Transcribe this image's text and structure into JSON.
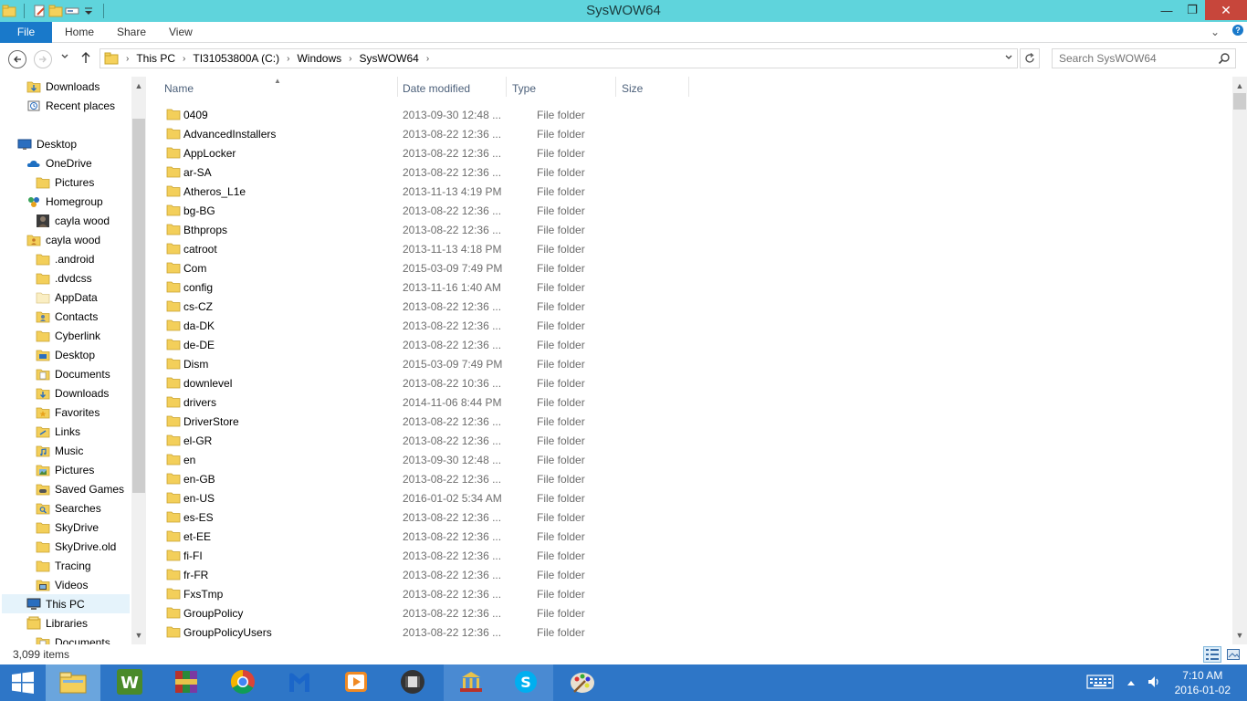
{
  "window": {
    "title": "SysWOW64",
    "minimize": "—",
    "maximize": "❐",
    "close": "✕"
  },
  "ribbon": {
    "tabs": [
      "File",
      "Home",
      "Share",
      "View"
    ],
    "expand": "⌄",
    "help": "?"
  },
  "address": {
    "crumbs": [
      "This PC",
      "TI31053800A (C:)",
      "Windows",
      "SysWOW64"
    ],
    "separator": "›"
  },
  "search": {
    "placeholder": "Search SysWOW64"
  },
  "nav": {
    "items": [
      {
        "label": "Downloads",
        "icon": "downloads-folder-icon"
      },
      {
        "label": "Recent places",
        "icon": "recent-places-icon"
      },
      {
        "label": "Desktop",
        "icon": "desktop-icon"
      },
      {
        "label": "OneDrive",
        "icon": "onedrive-icon"
      },
      {
        "label": "Pictures",
        "icon": "folder-icon"
      },
      {
        "label": "Homegroup",
        "icon": "homegroup-icon"
      },
      {
        "label": "cayla wood",
        "icon": "user-avatar-icon"
      },
      {
        "label": "cayla wood",
        "icon": "user-folder-icon"
      },
      {
        "label": ".android",
        "icon": "folder-icon"
      },
      {
        "label": ".dvdcss",
        "icon": "folder-icon"
      },
      {
        "label": "AppData",
        "icon": "hidden-folder-icon"
      },
      {
        "label": "Contacts",
        "icon": "contacts-folder-icon"
      },
      {
        "label": "Cyberlink",
        "icon": "folder-icon"
      },
      {
        "label": "Desktop",
        "icon": "desktop-folder-icon"
      },
      {
        "label": "Documents",
        "icon": "documents-folder-icon"
      },
      {
        "label": "Downloads",
        "icon": "downloads-folder-icon"
      },
      {
        "label": "Favorites",
        "icon": "favorites-folder-icon"
      },
      {
        "label": "Links",
        "icon": "links-folder-icon"
      },
      {
        "label": "Music",
        "icon": "music-folder-icon"
      },
      {
        "label": "Pictures",
        "icon": "pictures-folder-icon"
      },
      {
        "label": "Saved Games",
        "icon": "saved-games-folder-icon"
      },
      {
        "label": "Searches",
        "icon": "searches-folder-icon"
      },
      {
        "label": "SkyDrive",
        "icon": "folder-icon"
      },
      {
        "label": "SkyDrive.old",
        "icon": "folder-icon"
      },
      {
        "label": "Tracing",
        "icon": "folder-icon"
      },
      {
        "label": "Videos",
        "icon": "videos-folder-icon"
      },
      {
        "label": "This PC",
        "icon": "this-pc-icon"
      },
      {
        "label": "Libraries",
        "icon": "libraries-icon"
      },
      {
        "label": "Documents",
        "icon": "documents-folder-icon"
      }
    ]
  },
  "columns": {
    "name": "Name",
    "date": "Date modified",
    "type": "Type",
    "size": "Size"
  },
  "files": [
    {
      "name": "0409",
      "date": "2013-09-30 12:48 ...",
      "type": "File folder"
    },
    {
      "name": "AdvancedInstallers",
      "date": "2013-08-22 12:36 ...",
      "type": "File folder"
    },
    {
      "name": "AppLocker",
      "date": "2013-08-22 12:36 ...",
      "type": "File folder"
    },
    {
      "name": "ar-SA",
      "date": "2013-08-22 12:36 ...",
      "type": "File folder"
    },
    {
      "name": "Atheros_L1e",
      "date": "2013-11-13 4:19 PM",
      "type": "File folder"
    },
    {
      "name": "bg-BG",
      "date": "2013-08-22 12:36 ...",
      "type": "File folder"
    },
    {
      "name": "Bthprops",
      "date": "2013-08-22 12:36 ...",
      "type": "File folder"
    },
    {
      "name": "catroot",
      "date": "2013-11-13 4:18 PM",
      "type": "File folder"
    },
    {
      "name": "Com",
      "date": "2015-03-09 7:49 PM",
      "type": "File folder"
    },
    {
      "name": "config",
      "date": "2013-11-16 1:40 AM",
      "type": "File folder"
    },
    {
      "name": "cs-CZ",
      "date": "2013-08-22 12:36 ...",
      "type": "File folder"
    },
    {
      "name": "da-DK",
      "date": "2013-08-22 12:36 ...",
      "type": "File folder"
    },
    {
      "name": "de-DE",
      "date": "2013-08-22 12:36 ...",
      "type": "File folder"
    },
    {
      "name": "Dism",
      "date": "2015-03-09 7:49 PM",
      "type": "File folder"
    },
    {
      "name": "downlevel",
      "date": "2013-08-22 10:36 ...",
      "type": "File folder"
    },
    {
      "name": "drivers",
      "date": "2014-11-06 8:44 PM",
      "type": "File folder"
    },
    {
      "name": "DriverStore",
      "date": "2013-08-22 12:36 ...",
      "type": "File folder"
    },
    {
      "name": "el-GR",
      "date": "2013-08-22 12:36 ...",
      "type": "File folder"
    },
    {
      "name": "en",
      "date": "2013-09-30 12:48 ...",
      "type": "File folder"
    },
    {
      "name": "en-GB",
      "date": "2013-08-22 12:36 ...",
      "type": "File folder"
    },
    {
      "name": "en-US",
      "date": "2016-01-02 5:34 AM",
      "type": "File folder"
    },
    {
      "name": "es-ES",
      "date": "2013-08-22 12:36 ...",
      "type": "File folder"
    },
    {
      "name": "et-EE",
      "date": "2013-08-22 12:36 ...",
      "type": "File folder"
    },
    {
      "name": "fi-FI",
      "date": "2013-08-22 12:36 ...",
      "type": "File folder"
    },
    {
      "name": "fr-FR",
      "date": "2013-08-22 12:36 ...",
      "type": "File folder"
    },
    {
      "name": "FxsTmp",
      "date": "2013-08-22 12:36 ...",
      "type": "File folder"
    },
    {
      "name": "GroupPolicy",
      "date": "2013-08-22 12:36 ...",
      "type": "File folder"
    },
    {
      "name": "GroupPolicyUsers",
      "date": "2013-08-22 12:36 ...",
      "type": "File folder"
    }
  ],
  "status": {
    "count": "3,099 items"
  },
  "taskbar": {
    "apps": [
      {
        "name": "file-explorer",
        "icon": "file-explorer-icon",
        "state": "active"
      },
      {
        "name": "wordperfect",
        "icon": "wordperfect-icon",
        "state": "idle"
      },
      {
        "name": "winrar",
        "icon": "winrar-icon",
        "state": "idle"
      },
      {
        "name": "chrome",
        "icon": "chrome-icon",
        "state": "idle"
      },
      {
        "name": "malwarebytes",
        "icon": "malwarebytes-icon",
        "state": "idle"
      },
      {
        "name": "media-player",
        "icon": "media-player-icon",
        "state": "idle"
      },
      {
        "name": "video-editor",
        "icon": "video-editor-icon",
        "state": "idle"
      },
      {
        "name": "museum-app",
        "icon": "museum-app-icon",
        "state": "running"
      },
      {
        "name": "skype",
        "icon": "skype-icon",
        "state": "running"
      },
      {
        "name": "paint",
        "icon": "paint-icon",
        "state": "idle"
      }
    ],
    "time": "7:10 AM",
    "date": "2016-01-02"
  },
  "colors": {
    "titlebar": "#5fd4dc",
    "file_tab": "#1979ca",
    "taskbar": "#2e76c7",
    "close": "#c7463b",
    "folder": "#e8c250"
  }
}
